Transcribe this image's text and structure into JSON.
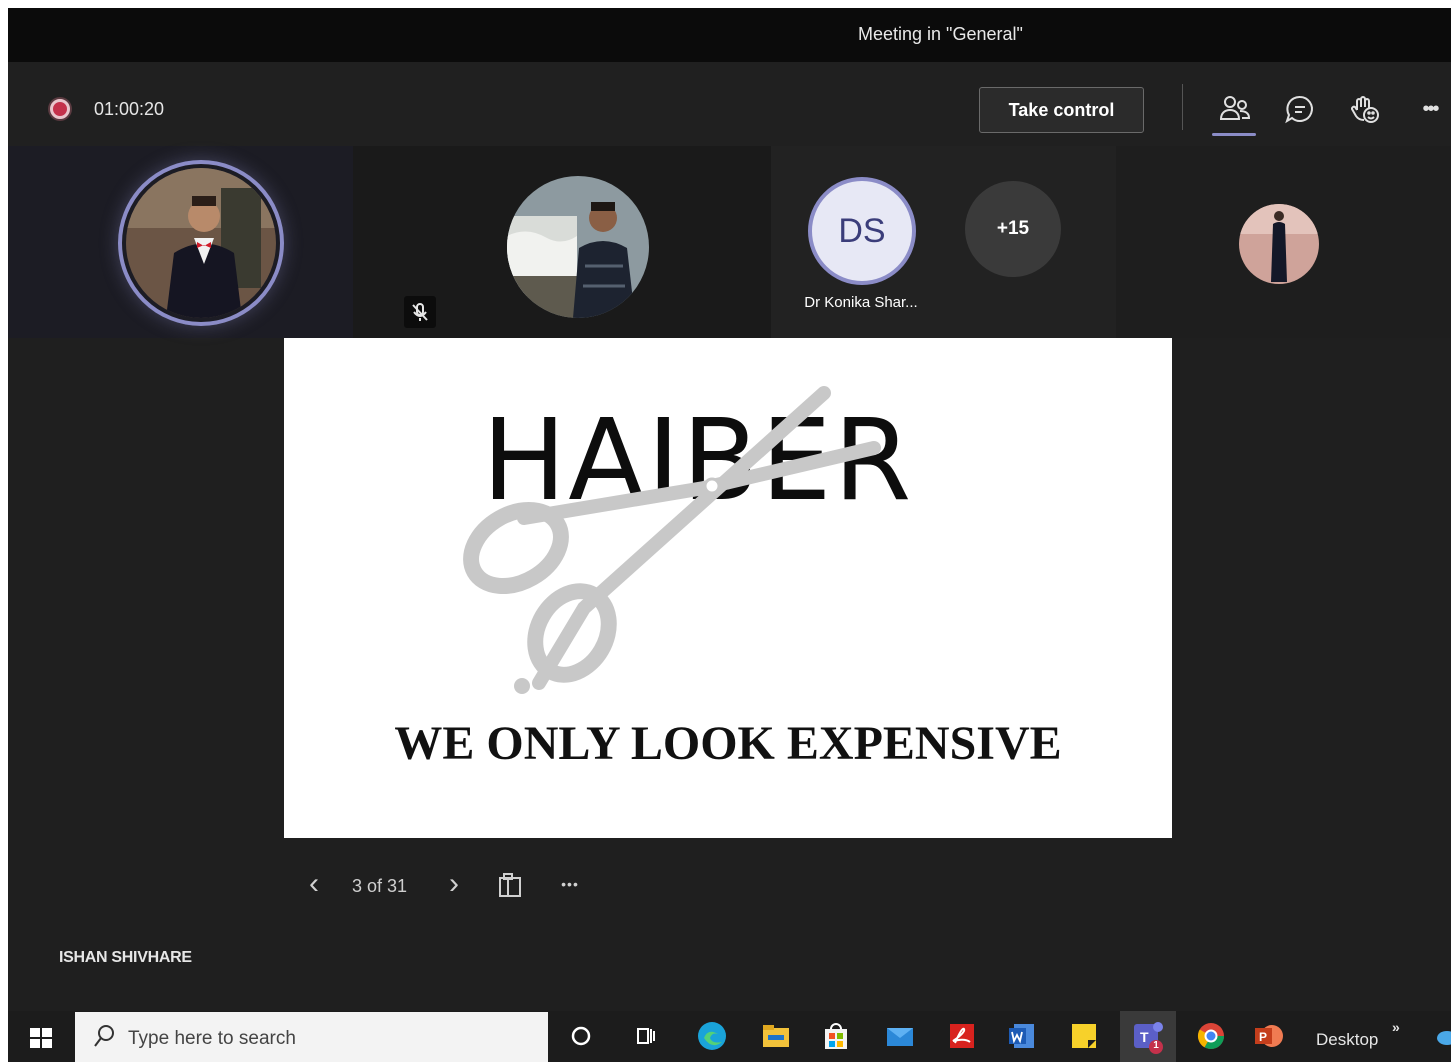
{
  "window": {
    "title": "Meeting in \"General\""
  },
  "control_bar": {
    "recording_icon": "record-dot-icon",
    "timer": "01:00:20",
    "take_control_label": "Take control",
    "icons": [
      "people-icon",
      "chat-icon",
      "reactions-icon",
      "more-options-icon"
    ],
    "more_options_glyph": "•••"
  },
  "participants": {
    "tiles": [
      {
        "kind": "photo",
        "speaking": true
      },
      {
        "kind": "photo",
        "muted": true
      },
      {
        "initials": "DS",
        "name": "Dr Konika Shar..."
      },
      {
        "kind": "photo"
      }
    ],
    "overflow_count": "+15"
  },
  "slide": {
    "brand": "HAIBER",
    "tagline": "WE ONLY LOOK EXPENSIVE"
  },
  "slide_controls": {
    "page_counter": "3 of 31",
    "prev_glyph": "‹",
    "next_glyph": "›",
    "more_glyph": "•••"
  },
  "presenter_name": "ISHAN SHIVHARE",
  "taskbar": {
    "search_placeholder": "Type here to search",
    "desktop_label": "Desktop",
    "overflow_glyph": "»",
    "apps": [
      "cortana",
      "task-view",
      "edge",
      "file-explorer",
      "store",
      "mail",
      "acrobat",
      "word",
      "sticky-notes",
      "teams",
      "chrome",
      "powerpoint"
    ],
    "teams_badge": "1"
  },
  "colors": {
    "app_bg": "#1f1f1f",
    "accent": "#8b8cc7",
    "record": "#c4314b"
  }
}
